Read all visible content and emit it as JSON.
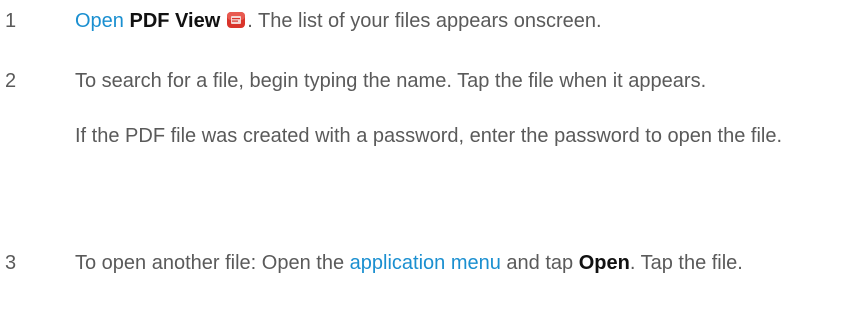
{
  "steps": [
    {
      "number": "1",
      "link_open": "Open",
      "app_name": "PDF View",
      "after_icon": ". The list of your files appears onscreen.",
      "icon": "pdf-view-app-icon"
    },
    {
      "number": "2",
      "paragraph1": "To search for a file, begin typing the name. Tap the file when it appears.",
      "paragraph2": "If the PDF file was created with a password, enter the password to open the file."
    },
    {
      "number": "3",
      "text_before_link": "To open another file: Open the ",
      "link_text": "application menu",
      "text_after_link": " and tap ",
      "bold_text": "Open",
      "text_end": ". Tap the file."
    }
  ],
  "colors": {
    "text": "#5a5a5a",
    "link": "#1a8fd0",
    "bold": "#111111",
    "icon_red": "#d9342b"
  }
}
